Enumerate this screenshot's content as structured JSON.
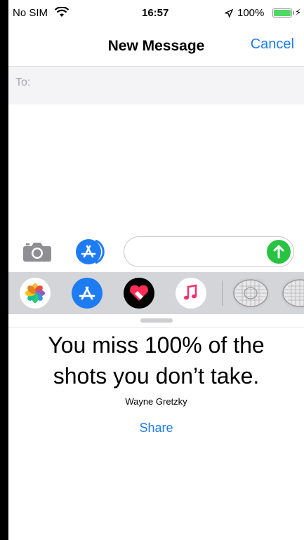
{
  "status_bar": {
    "carrier": "No SIM",
    "time": "16:57",
    "battery": "100%",
    "battery_level": 1.0
  },
  "nav": {
    "title": "New Message",
    "cancel_label": "Cancel"
  },
  "to_field": {
    "label": "To:",
    "value": ""
  },
  "compose": {
    "message_value": ""
  },
  "app_strip": {
    "items": [
      "photos-icon",
      "app-store-icon",
      "digital-touch-icon",
      "music-icon",
      "sticker-icon",
      "sticker-icon"
    ]
  },
  "quote_card": {
    "quote_line1": "You miss 100% of the",
    "quote_line2": "shots you don’t take.",
    "author": "Wayne Gretzky",
    "share_label": "Share"
  },
  "colors": {
    "accent": "#1e7cf2",
    "send": "#27c341",
    "strip_bg": "#d4d5d9"
  }
}
